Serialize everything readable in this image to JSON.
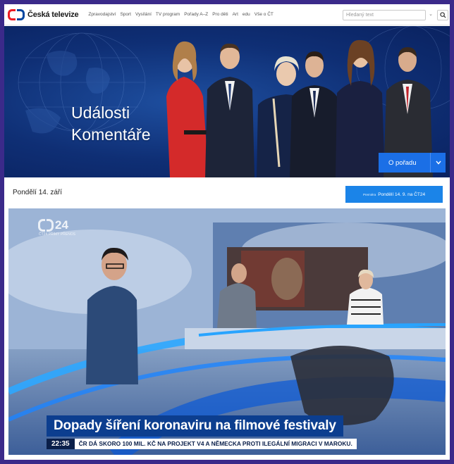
{
  "header": {
    "logo_text": "Česká televize",
    "nav": [
      "Zpravodajství",
      "Sport",
      "Vysílání",
      "TV program",
      "Pořady A–Z",
      "Pro děti",
      "Art",
      "edu",
      "Vše o ČT"
    ],
    "search_placeholder": "Hledaný text"
  },
  "hero": {
    "title_line1": "Události",
    "title_line2": "Komentáře",
    "button_label": "O pořadu"
  },
  "episode": {
    "date_label": "Pondělí 14. září",
    "air_button_prefix": "Premiéra",
    "air_button_label": "Pondělí 14. 9. na ČT24"
  },
  "video": {
    "channel_number": "24",
    "channel_sub": "ČT24 PŘÍMÝ PŘENOS",
    "headline": "Dopady šíření koronaviru na filmové festivaly",
    "ticker_time": "22:35",
    "ticker_text": "ČR DÁ SKORO 100 MIL. KČ NA PROJEKT V4 A NĚMECKA PROTI ILEGÁLNÍ MIGRACI V MAROKU."
  },
  "colors": {
    "accent_blue": "#1b6fe6",
    "logo_red": "#ed1c24",
    "hero_bg": "#0f2f75",
    "headline_bg": "#0c3e8f"
  }
}
